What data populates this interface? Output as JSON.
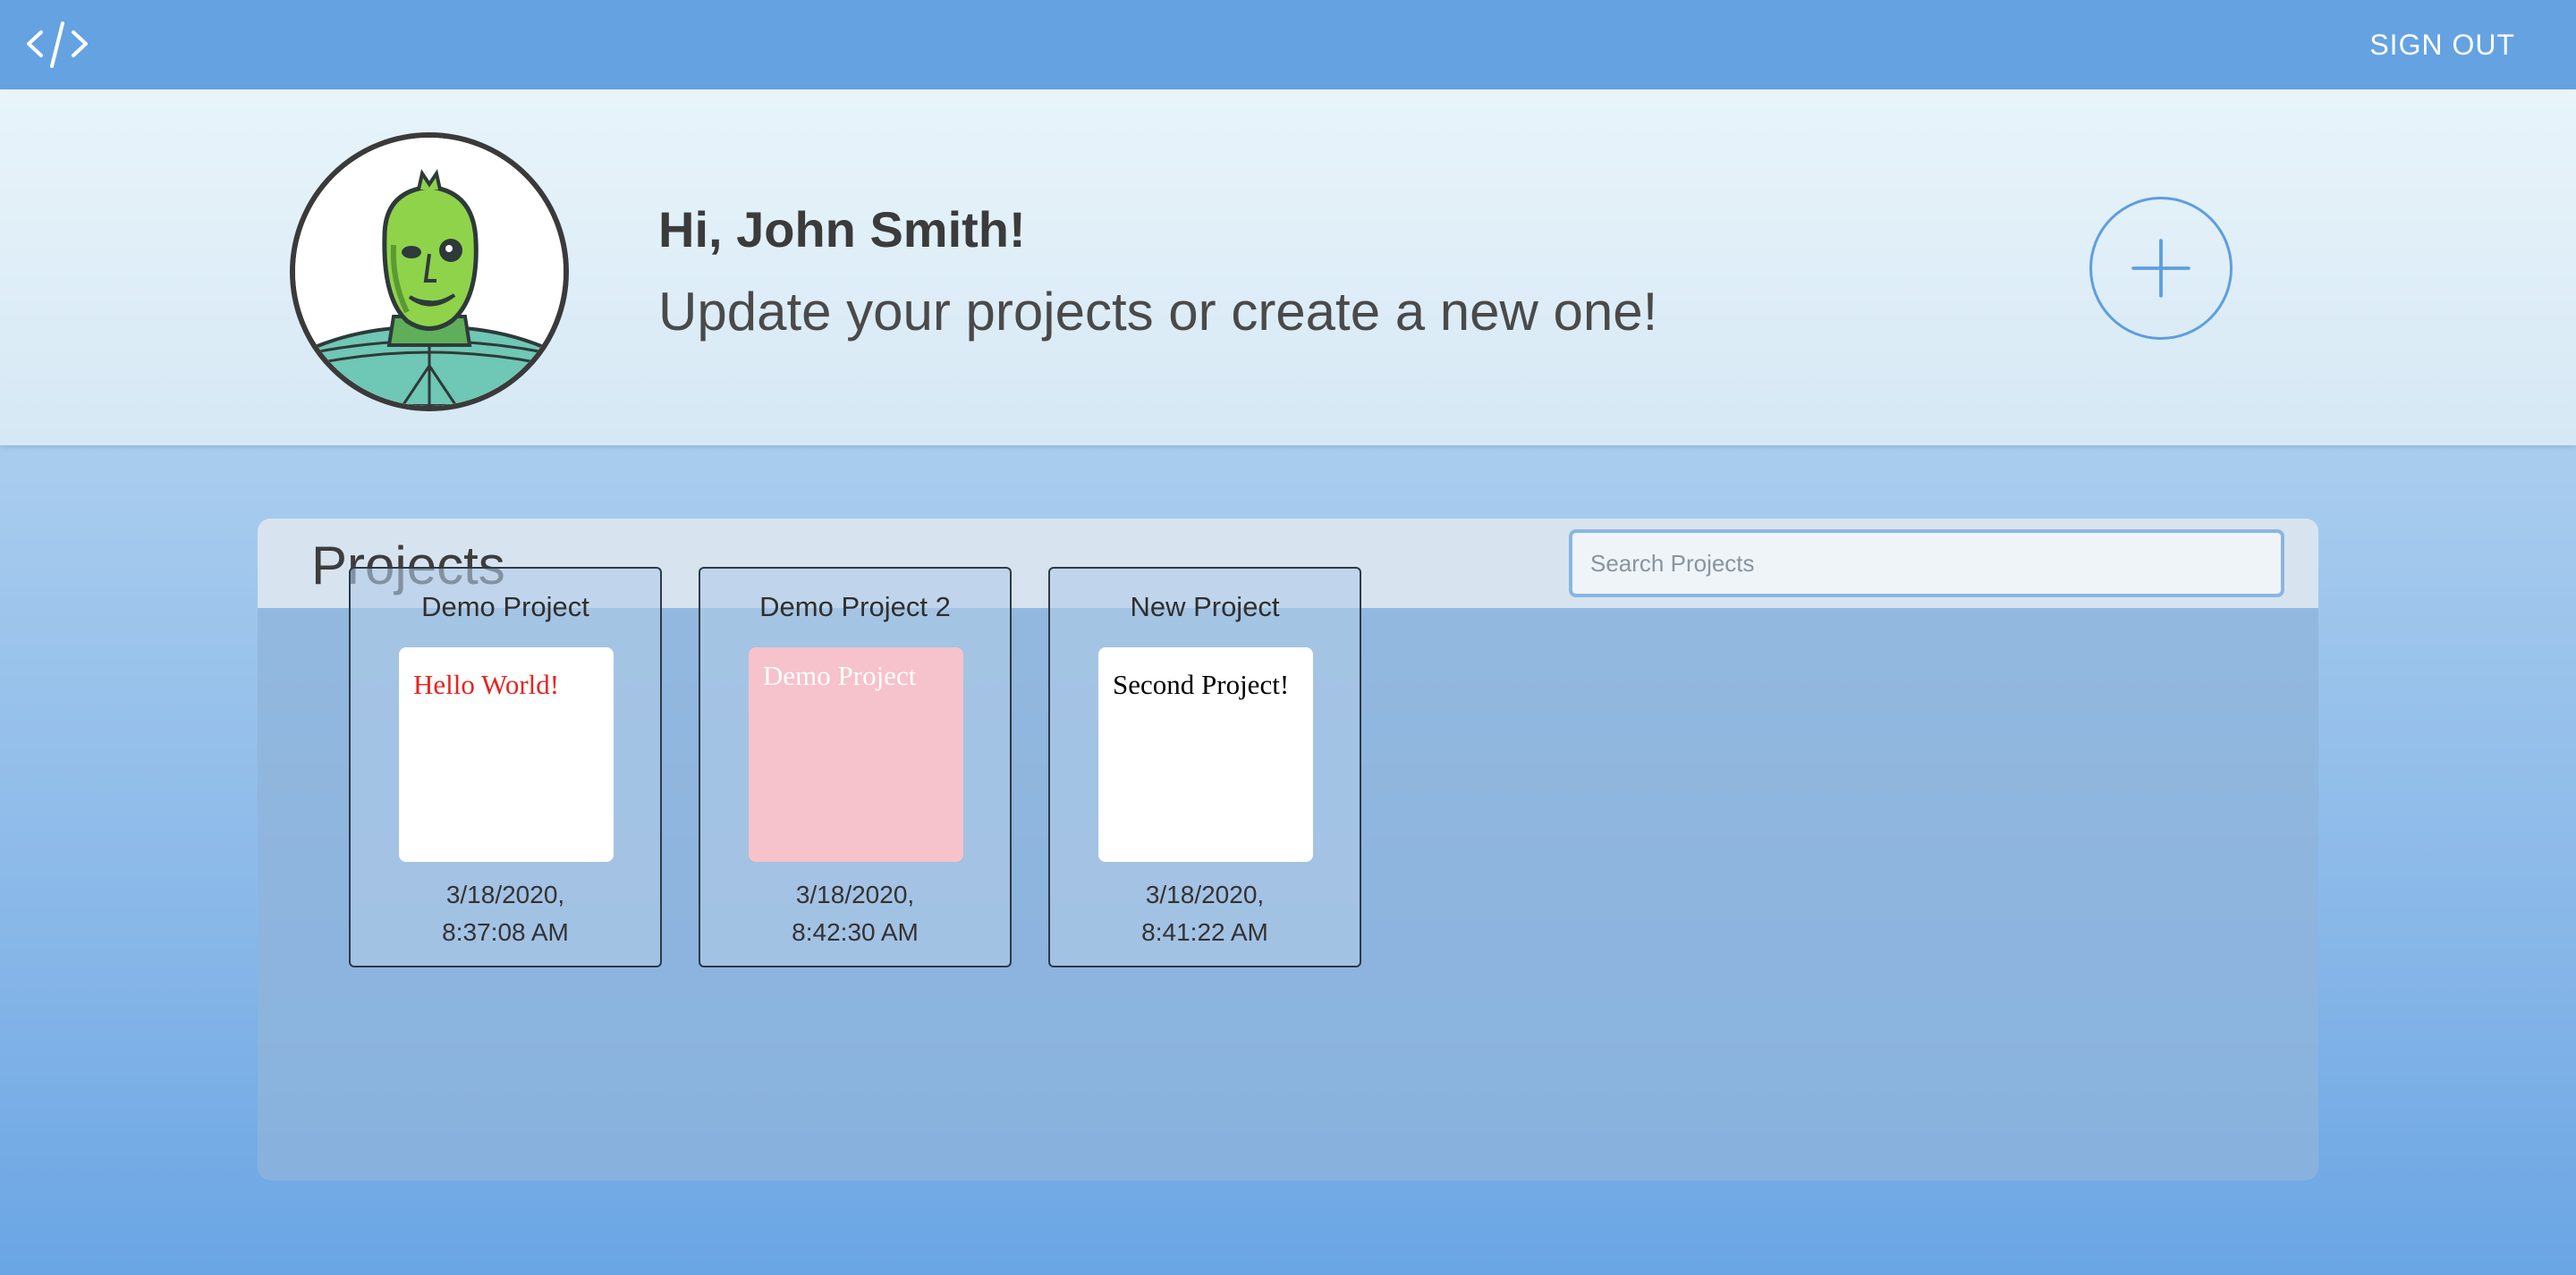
{
  "nav": {
    "logo_icon": "code-brackets-icon",
    "sign_out_label": "SIGN OUT"
  },
  "hero": {
    "avatar_icon": "user-avatar",
    "greeting": "Hi, John Smith!",
    "subtitle": "Update your projects or create a new one!",
    "add_icon": "plus-icon"
  },
  "projects": {
    "title": "Projects",
    "search_placeholder": "Search Projects",
    "search_value": "",
    "items": [
      {
        "name": "Demo Project",
        "preview_text": "Hello World!",
        "preview_text_color": "#e8231f",
        "preview_bg": "#ffffff",
        "date": "3/18/2020,",
        "time": "8:37:08 AM"
      },
      {
        "name": "Demo Project 2",
        "preview_text": "Demo Project",
        "preview_text_color": "#ffffff",
        "preview_bg": "#f6c2cb",
        "date": "3/18/2020,",
        "time": "8:42:30 AM"
      },
      {
        "name": "New Project",
        "preview_text": "Second Project!",
        "preview_text_color": "#000000",
        "preview_bg": "#ffffff",
        "date": "3/18/2020,",
        "time": "8:41:22 AM"
      }
    ]
  },
  "colors": {
    "topbar": "#65a2e2",
    "accent": "#5d9ee0",
    "card_border": "#2f3a46"
  }
}
